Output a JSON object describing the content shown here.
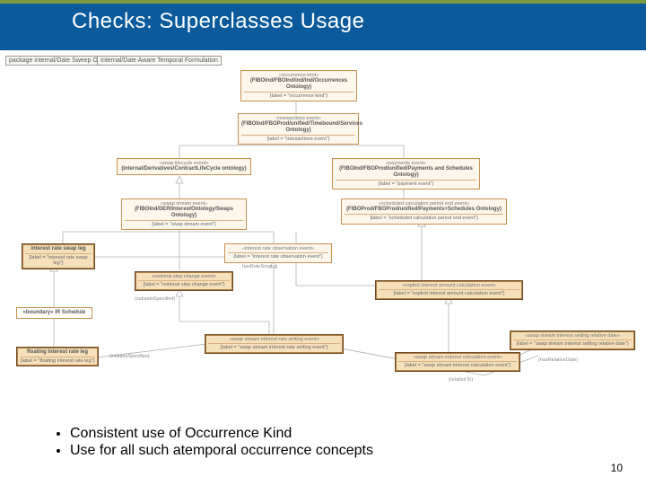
{
  "header": {
    "title": "Checks: Superclasses Usage"
  },
  "pkg1": "package internal/Date Sweep Ontology",
  "pkg2": "Internal/Date Aware Temporal Formulation",
  "nodes": {
    "root": {
      "stereo": "«occurrence kind»",
      "name": "(FIBOInd/FBOInd/ind/Ind/Occurrences Ontology)",
      "attr": "{label = \"occurrence kind\"}"
    },
    "trans": {
      "stereo": "«transactions event»",
      "name": "(FIBOInd/FBOProd/unified/Timebound/Services Ontology)",
      "attr": "{label = \"transactions event\"}"
    },
    "lifecycle": {
      "stereo": "«swap lifecycle event»",
      "name": "(Internal/Derivatives/ContractLifeCycle ontology)",
      "attr": ""
    },
    "payments": {
      "stereo": "«payments event»",
      "name": "(FIBOInd/FBOProd/unified/Payments and Schedules Ontology)",
      "attr": "{label = \"payment event\"}"
    },
    "swapstream": {
      "stereo": "«swap stream event»",
      "name": "(FIBOInd/DER/InterestOntology/Swaps Ontology)",
      "attr": "{label = \"swap stream event\"}"
    },
    "scheduled": {
      "stereo": "«scheduled calculation period end event»",
      "name": "(FIBOProd/FBOProd/unified/Payments+Schedules Ontology)",
      "attr": "{label = \"scheduled calculation period end event\"}"
    },
    "rateobs": {
      "stereo": "«interest rate observation event»",
      "name": "",
      "attr": "{label = \"interest rate observation event\"}"
    },
    "swapleg": {
      "name": "interest rate swap leg",
      "attr": "{label = \"interest rate swap leg\"}"
    },
    "notional": {
      "stereo": "«notional step change event»",
      "name": "",
      "attr": "{label = \"notional step change event\"}"
    },
    "explicitcalc": {
      "stereo": "«explicit interest amount calculation event»",
      "name": "",
      "attr": "{label = \"explicit interest amount calculation event\"}"
    },
    "boundary": {
      "name": "«boundary» IR Schedule",
      "attr": ""
    },
    "floating": {
      "name": "floating interest rate leg",
      "attr": "{label = \"floating interest rate leg\"}"
    },
    "settingevent": {
      "stereo": "«swap stream interest rate setting event»",
      "name": "",
      "attr": "{label = \"swap stream interest rate setting event\"}"
    },
    "calcevent": {
      "stereo": "«swap stream interest calculation event»",
      "name": "",
      "attr": "{label = \"swap stream interest calculation event\"}"
    },
    "reldate": {
      "stereo": "«swap stream interest setting relative date»",
      "name": "",
      "attr": "{label = \"swap stream interest setting relative date\"}"
    }
  },
  "edgeLabels": {
    "hasrate": "hasRateSource",
    "subsets": "(subsetsSpecified)",
    "relto": "(relativeTo)",
    "relsrc": "(hasRelativeDate)",
    "initiates": "(initiatesSpecifies)"
  },
  "bullets": [
    "Consistent use of Occurrence Kind",
    "Use for all such atemporal occurrence concepts"
  ],
  "pageNumber": "10",
  "chart_data": {
    "type": "diagram",
    "description": "UML-style ontology class diagram showing generalization hierarchy rooted at 'occurrence kind'. Arrows with hollow triangle heads indicate subclass-of (generalization) relationships pointing toward the superclass.",
    "nodes": [
      "occurrence kind",
      "transactions event",
      "swap lifecycle event",
      "payments event",
      "swap stream event",
      "scheduled calculation period end event",
      "interest rate observation event",
      "interest rate swap leg",
      "notional step change event",
      "explicit interest amount calculation event",
      "boundary IR Schedule",
      "floating interest rate leg",
      "swap stream interest rate setting event",
      "swap stream interest calculation event",
      "swap stream interest setting relative date"
    ],
    "generalizations": [
      [
        "transactions event",
        "occurrence kind"
      ],
      [
        "swap lifecycle event",
        "transactions event"
      ],
      [
        "payments event",
        "transactions event"
      ],
      [
        "swap stream event",
        "swap lifecycle event"
      ],
      [
        "scheduled calculation period end event",
        "payments event"
      ],
      [
        "interest rate observation event",
        "swap stream event"
      ],
      [
        "notional step change event",
        "swap stream event"
      ],
      [
        "explicit interest amount calculation event",
        "swap stream event"
      ],
      [
        "explicit interest amount calculation event",
        "scheduled calculation period end event"
      ],
      [
        "swap stream interest rate setting event",
        "interest rate observation event"
      ],
      [
        "swap stream interest rate setting event",
        "notional step change event"
      ],
      [
        "swap stream interest calculation event",
        "explicit interest amount calculation event"
      ],
      [
        "floating interest rate leg",
        "interest rate swap leg"
      ]
    ],
    "associations": [
      {
        "from": "interest rate swap leg",
        "to": "interest rate observation event",
        "label": "hasRateSource"
      },
      {
        "from": "floating interest rate leg",
        "to": "swap stream interest rate setting event",
        "label": "initiatesSpecifies"
      },
      {
        "from": "swap stream interest calculation event",
        "to": "swap stream interest setting relative date",
        "label": "hasRelativeDate"
      },
      {
        "from": "swap stream interest setting relative date",
        "to": "swap stream interest rate setting event",
        "label": "relativeTo"
      }
    ]
  }
}
